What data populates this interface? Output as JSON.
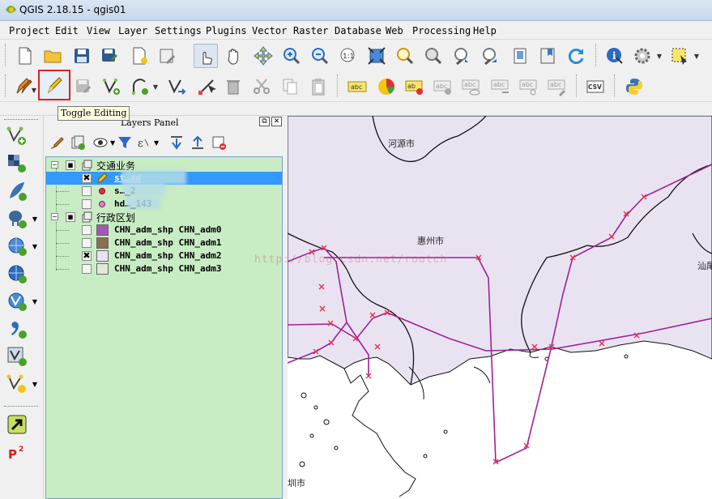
{
  "window": {
    "title": "QGIS 2.18.15 - qgis01"
  },
  "menu": [
    "Project",
    "Edit",
    "View",
    "Layer",
    "Settings",
    "Plugins",
    "Vector",
    "Raster",
    "Database",
    "Web",
    "Processing",
    "Help"
  ],
  "tooltip": "Toggle Editing",
  "layers_panel": {
    "title": "Layers Panel",
    "groups": [
      {
        "name": "交通业务",
        "layers": [
          {
            "name": "st…ad",
            "visible": true,
            "selected": true
          },
          {
            "name": "s…_2",
            "visible": false
          },
          {
            "name": "hd…_143",
            "visible": false
          }
        ]
      },
      {
        "name": "行政区划",
        "layers": [
          {
            "name": "CHN_adm_shp CHN_adm0",
            "visible": false,
            "color": "#a259b5"
          },
          {
            "name": "CHN_adm_shp CHN_adm1",
            "visible": false,
            "color": "#8c6e52"
          },
          {
            "name": "CHN_adm_shp CHN_adm2",
            "visible": true,
            "color": "#e8e2f0"
          },
          {
            "name": "CHN_adm_shp CHN_adm3",
            "visible": false,
            "color": "#e6e6d8"
          }
        ]
      }
    ]
  },
  "map": {
    "labels": {
      "heyuan": "河源市",
      "huizhou": "惠州市",
      "shantou": "汕尾",
      "shenzhen": "圳市"
    },
    "watermark": "http://blog.csdn.net/rootch",
    "colors": {
      "land": "#e9e3f1",
      "boundary": "#111111",
      "route": "#a0209a",
      "marker": "#e8304a"
    }
  }
}
